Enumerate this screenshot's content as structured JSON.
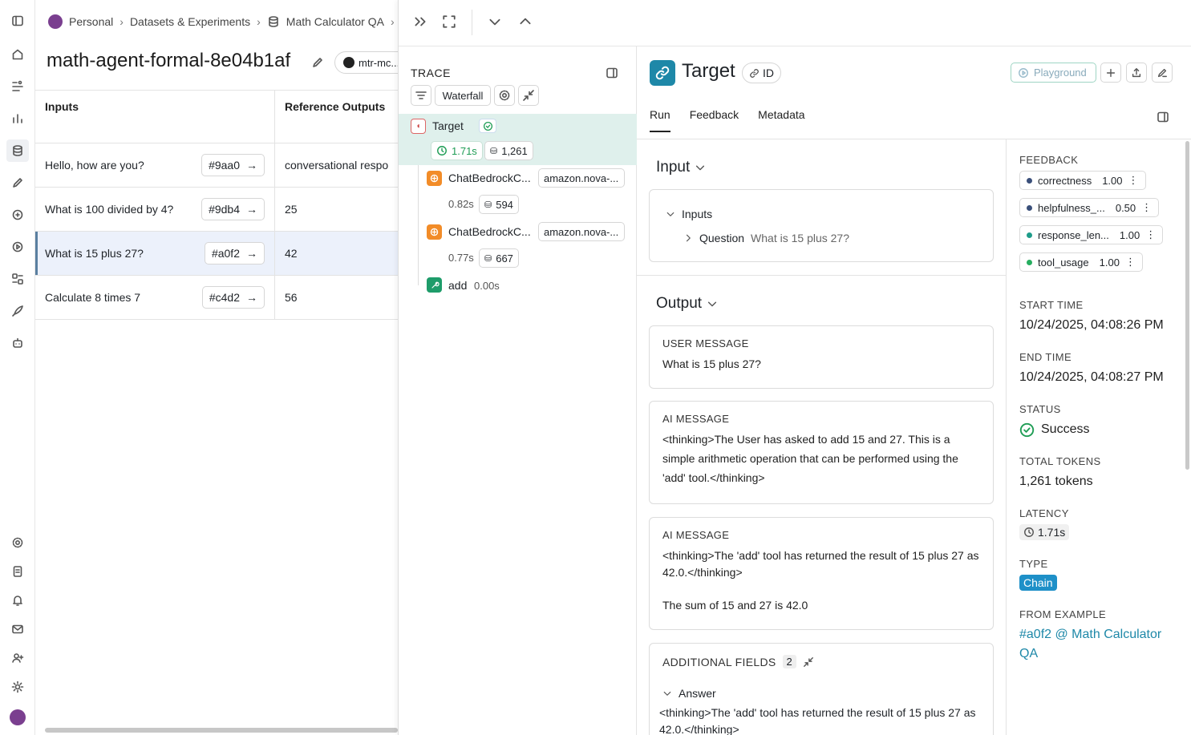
{
  "breadcrumb": {
    "workspace": "Personal",
    "section": "Datasets & Experiments",
    "dataset": "Math Calculator QA"
  },
  "experiment": {
    "title": "math-agent-formal-8e04b1af",
    "repo": "mtr-mc..."
  },
  "table": {
    "headers": [
      "Inputs",
      "Reference Outputs"
    ],
    "rows": [
      {
        "input": "Hello, how are you?",
        "id": "#9aa0",
        "ref": "conversational respo"
      },
      {
        "input": "What is 100 divided by 4?",
        "id": "#9db4",
        "ref": "25"
      },
      {
        "input": "What is 15 plus 27?",
        "id": "#a0f2",
        "ref": "42"
      },
      {
        "input": "Calculate 8 times 7",
        "id": "#c4d2",
        "ref": "56"
      }
    ]
  },
  "trace": {
    "header": "TRACE",
    "view": "Waterfall",
    "root": {
      "name": "Target",
      "latency": "1.71s",
      "tokens": "1,261"
    },
    "children": [
      {
        "name": "ChatBedrockC...",
        "model": "amazon.nova-...",
        "latency": "0.82s",
        "tokens": "594"
      },
      {
        "name": "ChatBedrockC...",
        "model": "amazon.nova-...",
        "latency": "0.77s",
        "tokens": "667"
      },
      {
        "name": "add",
        "latency": "0.00s"
      }
    ]
  },
  "run": {
    "name": "Target",
    "id_label": "ID",
    "playground_label": "Playground",
    "tabs": [
      "Run",
      "Feedback",
      "Metadata"
    ],
    "input_title": "Input",
    "inputs_label": "Inputs",
    "question_label": "Question",
    "question_value": "What is 15 plus 27?",
    "output_title": "Output",
    "messages": [
      {
        "label": "USER MESSAGE",
        "text": "What is 15 plus 27?"
      },
      {
        "label": "AI MESSAGE",
        "text": "<thinking>The User has asked to add 15 and 27. This is a simple arithmetic operation that can be performed using the 'add' tool.</thinking>"
      },
      {
        "label": "AI MESSAGE",
        "text": "<thinking>The 'add' tool has returned the result of 15 plus 27 as 42.0.</thinking>",
        "text2": "The sum of 15 and 27 is 42.0"
      }
    ],
    "additional_label": "ADDITIONAL FIELDS",
    "additional_count": "2",
    "answer_label": "Answer",
    "answer_text": "<thinking>The 'add' tool has returned the result of 15 plus 27 as 42.0.</thinking>"
  },
  "sidebar": {
    "feedback_label": "FEEDBACK",
    "feedback": [
      {
        "name": "correctness",
        "score": "1.00",
        "color": "#3a4f7a"
      },
      {
        "name": "helpfulness_...",
        "score": "0.50",
        "color": "#3a4f7a"
      },
      {
        "name": "response_len...",
        "score": "1.00",
        "color": "#1e9c8a"
      },
      {
        "name": "tool_usage",
        "score": "1.00",
        "color": "#27ae60"
      }
    ],
    "start_label": "START TIME",
    "start_value": "10/24/2025, 04:08:26 PM",
    "end_label": "END TIME",
    "end_value": "10/24/2025, 04:08:27 PM",
    "status_label": "STATUS",
    "status_value": "Success",
    "tokens_label": "TOTAL TOKENS",
    "tokens_value": "1,261 tokens",
    "latency_label": "LATENCY",
    "latency_value": "1.71s",
    "type_label": "TYPE",
    "type_value": "Chain",
    "example_label": "FROM EXAMPLE",
    "example_value": "#a0f2 @ Math Calculator QA"
  },
  "colors": {
    "accent": "#1e88a8",
    "success": "#1f9d55",
    "chain_badge": "#1e90c8",
    "selected_node": "#dff0ec"
  }
}
